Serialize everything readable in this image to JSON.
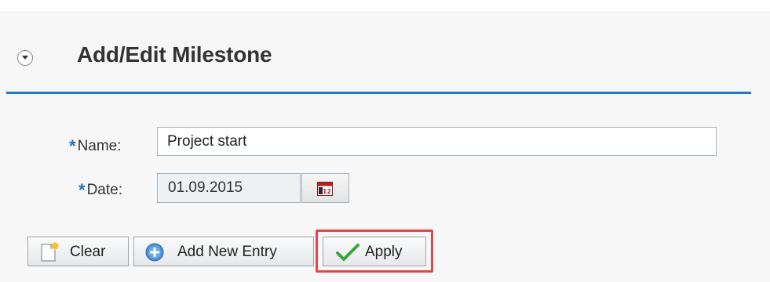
{
  "header": {
    "title": "Add/Edit Milestone",
    "collapse_icon": "chevron-down-circle-icon"
  },
  "form": {
    "name": {
      "required_marker": "*",
      "label": "Name:",
      "value": "Project start"
    },
    "date": {
      "required_marker": "*",
      "label": "Date:",
      "value": "01.09.2015",
      "picker_icon": "calendar-icon"
    }
  },
  "toolbar": {
    "clear_label": "Clear",
    "clear_icon": "new-document-icon",
    "add_label": "Add New Entry",
    "add_icon": "plus-circle-icon",
    "apply_label": "Apply",
    "apply_icon": "checkmark-icon",
    "highlighted_button": "apply"
  },
  "colors": {
    "accent": "#1f79c8",
    "required": "#1f6fbf",
    "highlight": "#e8444a",
    "apply_check": "#3aa53a"
  }
}
